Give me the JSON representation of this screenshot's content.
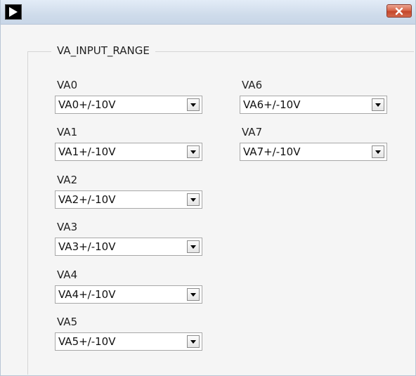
{
  "window": {
    "icons": {
      "app": "play-arrow-icon",
      "close": "close-x-icon"
    }
  },
  "group": {
    "legend": "VA_INPUT_RANGE"
  },
  "channels": [
    {
      "label": "VA0",
      "value": "VA0+/-10V"
    },
    {
      "label": "VA1",
      "value": "VA1+/-10V"
    },
    {
      "label": "VA2",
      "value": "VA2+/-10V"
    },
    {
      "label": "VA3",
      "value": "VA3+/-10V"
    },
    {
      "label": "VA4",
      "value": "VA4+/-10V"
    },
    {
      "label": "VA5",
      "value": "VA5+/-10V"
    },
    {
      "label": "VA6",
      "value": "VA6+/-10V"
    },
    {
      "label": "VA7",
      "value": "VA7+/-10V"
    }
  ],
  "colors": {
    "titlebar": "#cfdceb",
    "close_button": "#c4462a",
    "panel": "#f5f5f5"
  }
}
